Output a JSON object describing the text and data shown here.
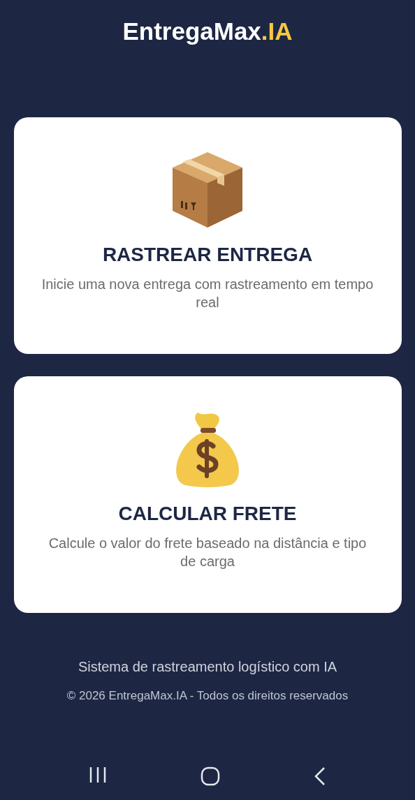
{
  "header": {
    "brand_name": "EntregaMax",
    "brand_suffix": ".IA"
  },
  "cards": [
    {
      "kind": "box",
      "title": "RASTREAR ENTREGA",
      "description": "Inicie uma nova entrega com rastreamento em tempo real"
    },
    {
      "kind": "moneybag",
      "title": "CALCULAR FRETE",
      "description": "Calcule o valor do frete baseado na distância e tipo de carga"
    }
  ],
  "footer": {
    "tagline": "Sistema de rastreamento logístico com IA",
    "copyright": "© 2026 EntregaMax.IA - Todos os direitos reservados"
  }
}
